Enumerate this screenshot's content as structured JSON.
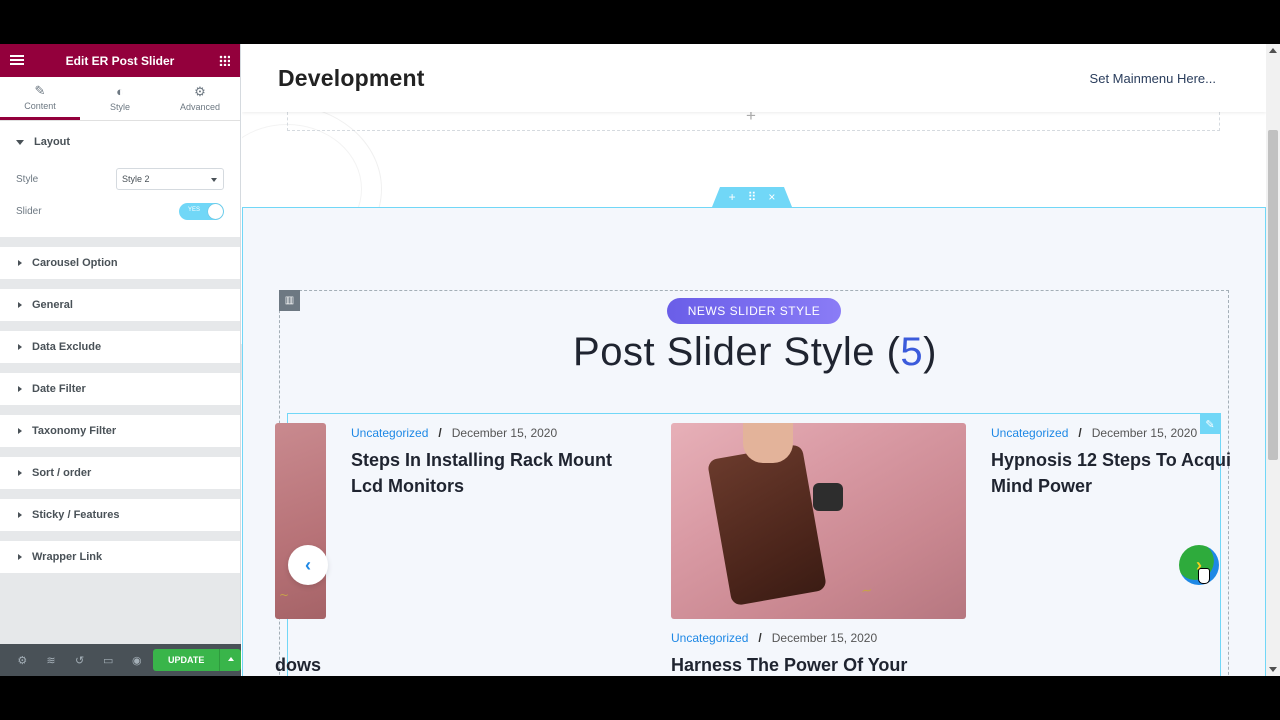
{
  "editor": {
    "title": "Edit ER Post Slider",
    "tabs": [
      {
        "label": "Content",
        "icon": "pencil-icon"
      },
      {
        "label": "Style",
        "icon": "half-circle-icon"
      },
      {
        "label": "Advanced",
        "icon": "gear-icon"
      }
    ],
    "layout_section": {
      "title": "Layout",
      "style_label": "Style",
      "style_value": "Style 2",
      "slider_label": "Slider",
      "slider_toggle": "YES"
    },
    "sections": [
      "Carousel Option",
      "General",
      "Data Exclude",
      "Date Filter",
      "Taxonomy Filter",
      "Sort / order",
      "Sticky / Features",
      "Wrapper Link"
    ],
    "footer": {
      "update_label": "UPDATE"
    }
  },
  "site": {
    "title": "Development",
    "menu": "Set Mainmenu Here..."
  },
  "widget": {
    "badge": "NEWS SLIDER STYLE",
    "heading_text": "Post Slider Style (",
    "heading_num": "5",
    "heading_end": ")"
  },
  "posts": [
    {
      "category": "Uncategorized",
      "date": "December 15, 2020",
      "title_line1": "Steps In Installing Rack Mount",
      "title_line2": "Lcd Monitors"
    },
    {
      "category": "Uncategorized",
      "date": "December 15, 2020",
      "title_line1": "Hypnosis 12 Steps To Acqui",
      "title_line2": "Mind Power"
    },
    {
      "category": "Uncategorized",
      "date": "December 15, 2020",
      "title_line1": "Harness The Power Of Your"
    },
    {
      "title_fragment": "dows"
    }
  ],
  "colors": {
    "editor_header": "#93003c",
    "accent": "#71d7f7",
    "update": "#39b54a",
    "link": "#1e88e5"
  }
}
